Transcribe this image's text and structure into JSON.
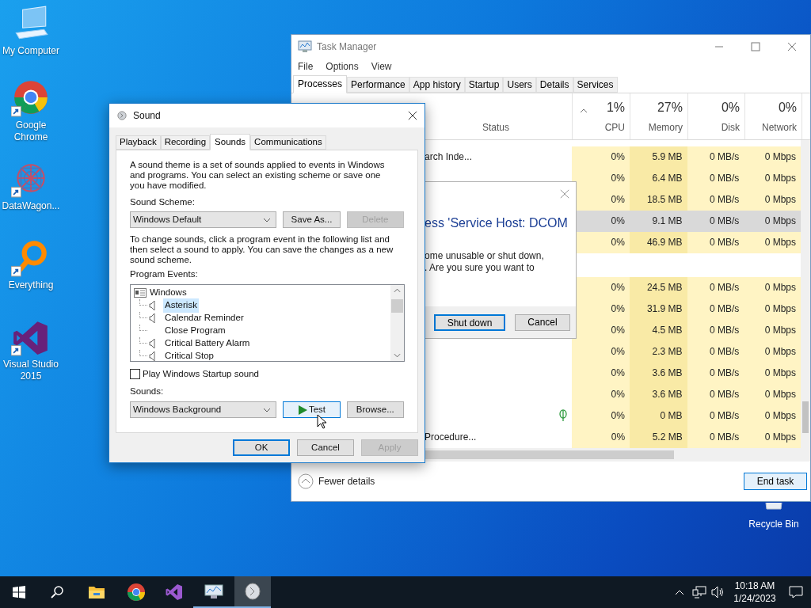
{
  "desktop": {
    "icons": [
      {
        "label": "My Computer",
        "kind": "computer",
        "shortcut": false
      },
      {
        "label": "Google Chrome",
        "kind": "chrome",
        "shortcut": true
      },
      {
        "label": "DataWagon...",
        "kind": "datawagon",
        "shortcut": true
      },
      {
        "label": "Everything",
        "kind": "everything",
        "shortcut": true
      },
      {
        "label": "Visual Studio 2015",
        "kind": "vs",
        "shortcut": true
      }
    ],
    "recycle_bin": {
      "label": "Recycle Bin"
    }
  },
  "task_manager": {
    "title": "Task Manager",
    "menu": [
      "File",
      "Options",
      "View"
    ],
    "tabs": [
      {
        "label": "Processes",
        "selected": true
      },
      {
        "label": "Performance",
        "selected": false
      },
      {
        "label": "App history",
        "selected": false
      },
      {
        "label": "Startup",
        "selected": false
      },
      {
        "label": "Users",
        "selected": false
      },
      {
        "label": "Details",
        "selected": false
      },
      {
        "label": "Services",
        "selected": false
      }
    ],
    "status_column": "Status",
    "columns": [
      {
        "usage": "1%",
        "label": "CPU",
        "sorted": true
      },
      {
        "usage": "27%",
        "label": "Memory",
        "sorted": false
      },
      {
        "usage": "0%",
        "label": "Disk",
        "sorted": false
      },
      {
        "usage": "0%",
        "label": "Network",
        "sorted": false
      }
    ],
    "rows": [
      {
        "kind": "process",
        "name": "arch Inde...",
        "cpu": "0%",
        "memory": "5.9 MB",
        "disk": "0 MB/s",
        "network": "0 Mbps",
        "selected": false
      },
      {
        "kind": "process",
        "cpu": "0%",
        "memory": "6.4 MB",
        "disk": "0 MB/s",
        "network": "0 Mbps",
        "selected": false
      },
      {
        "kind": "process",
        "cpu": "0%",
        "memory": "18.5 MB",
        "disk": "0 MB/s",
        "network": "0 Mbps",
        "selected": false
      },
      {
        "kind": "process",
        "cpu": "0%",
        "memory": "9.1 MB",
        "disk": "0 MB/s",
        "network": "0 Mbps",
        "selected": true
      },
      {
        "kind": "process",
        "cpu": "0%",
        "memory": "46.9 MB",
        "disk": "0 MB/s",
        "network": "0 Mbps",
        "selected": false
      },
      {
        "kind": "group"
      },
      {
        "kind": "process",
        "cpu": "0%",
        "memory": "24.5 MB",
        "disk": "0 MB/s",
        "network": "0 Mbps",
        "selected": false
      },
      {
        "kind": "process",
        "cpu": "0%",
        "memory": "31.9 MB",
        "disk": "0 MB/s",
        "network": "0 Mbps",
        "selected": false
      },
      {
        "kind": "process",
        "cpu": "0%",
        "memory": "4.5 MB",
        "disk": "0 MB/s",
        "network": "0 Mbps",
        "selected": false
      },
      {
        "kind": "process",
        "cpu": "0%",
        "memory": "2.3 MB",
        "disk": "0 MB/s",
        "network": "0 Mbps",
        "selected": false
      },
      {
        "kind": "process",
        "cpu": "0%",
        "memory": "3.6 MB",
        "disk": "0 MB/s",
        "network": "0 Mbps",
        "selected": false
      },
      {
        "kind": "process",
        "cpu": "0%",
        "memory": "3.6 MB",
        "disk": "0 MB/s",
        "network": "0 Mbps",
        "selected": false
      },
      {
        "kind": "eco_process",
        "cpu": "0%",
        "memory": "0 MB",
        "disk": "0 MB/s",
        "network": "0 Mbps",
        "selected": false
      },
      {
        "kind": "process",
        "name": "Procedure...",
        "cpu": "0%",
        "memory": "5.2 MB",
        "disk": "0 MB/s",
        "network": "0 Mbps",
        "selected": false
      }
    ],
    "fewer_details": "Fewer details",
    "end_task": "End task"
  },
  "confirm_dialog": {
    "heading": "ess 'Service Host: DCOM",
    "message": [
      "ome unusable or shut down,",
      ". Are you sure you want to"
    ],
    "buttons": [
      {
        "label": "Shut down",
        "default": true
      },
      {
        "label": "Cancel",
        "default": false
      }
    ]
  },
  "sound_dialog": {
    "title": "Sound",
    "tabs": [
      {
        "label": "Playback",
        "selected": false
      },
      {
        "label": "Recording",
        "selected": false
      },
      {
        "label": "Sounds",
        "selected": true
      },
      {
        "label": "Communications",
        "selected": false
      }
    ],
    "intro": "A sound theme is a set of sounds applied to events in Windows and programs.  You can select an existing scheme or save one you have modified.",
    "scheme_label": "Sound Scheme:",
    "scheme_value": "Windows Default",
    "scheme_buttons": [
      {
        "label": "Save As...",
        "disabled": false
      },
      {
        "label": "Delete",
        "disabled": true
      }
    ],
    "instructions": "To change sounds, click a program event in the following list and then select a sound to apply.  You can save the changes as a new sound scheme.",
    "events_label": "Program Events:",
    "events": [
      {
        "label": "Windows",
        "children": [
          {
            "label": "Asterisk",
            "has_sound": true,
            "selected": true
          },
          {
            "label": "Calendar Reminder",
            "has_sound": true,
            "selected": false
          },
          {
            "label": "Close Program",
            "has_sound": false,
            "selected": false
          },
          {
            "label": "Critical Battery Alarm",
            "has_sound": true,
            "selected": false
          },
          {
            "label": "Critical Stop",
            "has_sound": true,
            "selected": false
          }
        ]
      }
    ],
    "startup_checkbox": {
      "label": "Play Windows Startup sound",
      "checked": false
    },
    "sounds_label": "Sounds:",
    "sound_value": "Windows Background",
    "sound_buttons": [
      {
        "label": "Test",
        "kind": "test",
        "hovered": true
      },
      {
        "label": "Browse...",
        "kind": "plain",
        "hovered": false
      }
    ],
    "footer_buttons": [
      {
        "label": "OK",
        "default": true,
        "disabled": false
      },
      {
        "label": "Cancel",
        "default": false,
        "disabled": false
      },
      {
        "label": "Apply",
        "default": false,
        "disabled": true
      }
    ]
  },
  "taskbar": {
    "apps": [
      {
        "kind": "start",
        "running": false,
        "active": false
      },
      {
        "kind": "search",
        "running": false,
        "active": false
      },
      {
        "kind": "explorer",
        "running": false,
        "active": false
      },
      {
        "kind": "chrome",
        "running": false,
        "active": false
      },
      {
        "kind": "vs",
        "running": false,
        "active": false
      },
      {
        "kind": "taskmgr",
        "running": true,
        "active": false
      },
      {
        "kind": "sound",
        "running": true,
        "active": true
      }
    ],
    "time": "10:18 AM",
    "date": "1/24/2023"
  }
}
